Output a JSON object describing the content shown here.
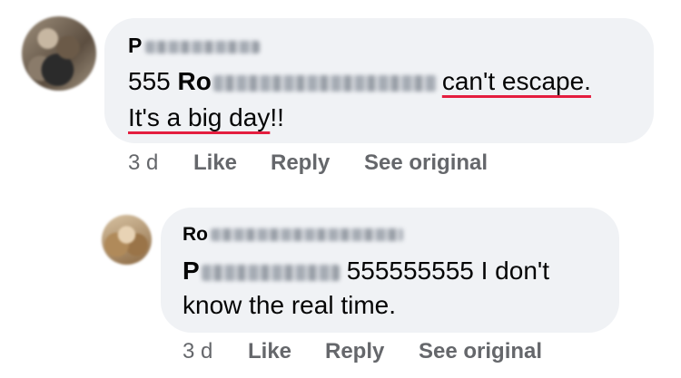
{
  "comments": [
    {
      "author_visible": "P",
      "text_prefix": "555 ",
      "mention_visible": "Ro",
      "text_line1_tail": "can't escape.",
      "text_line2": "It's a big day",
      "text_line2_end": "!!",
      "actions": {
        "time": "3 d",
        "like": "Like",
        "reply": "Reply",
        "see_original": "See original"
      }
    },
    {
      "author_visible": "Ro",
      "mention_visible": "P",
      "text_line1_tail": "555555555 I don't",
      "text_line2": "know the real time.",
      "actions": {
        "time": "3 d",
        "like": "Like",
        "reply": "Reply",
        "see_original": "See original"
      }
    }
  ],
  "colors": {
    "bubble_bg": "#f0f2f5",
    "secondary_text": "#65676b",
    "spellcheck_underline": "#e41e3f"
  }
}
